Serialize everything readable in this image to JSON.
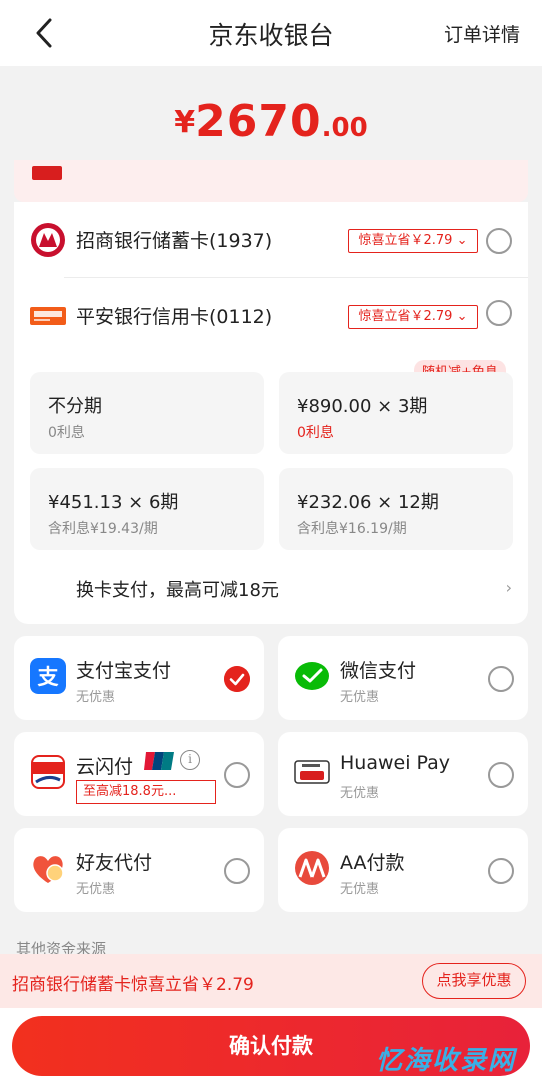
{
  "header": {
    "title": "京东收银台",
    "order_detail": "订单详情"
  },
  "amount": {
    "currency": "¥",
    "integer": "2670",
    "decimal": ".00"
  },
  "banks": [
    {
      "name": "招商银行储蓄卡(1937)",
      "promo": "惊喜立省￥2.79",
      "selected": false
    },
    {
      "name": "平安银行信用卡(0112)",
      "promo": "惊喜立省￥2.79",
      "selected": false
    }
  ],
  "installments": {
    "badge": "随机减+免息",
    "options": [
      {
        "main": "不分期",
        "sub": "0利息"
      },
      {
        "main": "¥890.00 × 3期",
        "sub": "0利息"
      },
      {
        "main": "¥451.13 × 6期",
        "sub": "含利息¥19.43/期"
      },
      {
        "main": "¥232.06 × 12期",
        "sub": "含利息¥16.19/期"
      }
    ]
  },
  "switch_card": {
    "label": "换卡支付，最高可减18元",
    "arrow": "›"
  },
  "payments": [
    {
      "name": "支付宝支付",
      "sub": "无优惠",
      "icon": "alipay-icon",
      "selected": true
    },
    {
      "name": "微信支付",
      "sub": "无优惠",
      "icon": "wechat-icon",
      "selected": false
    },
    {
      "name": "云闪付",
      "promo": "至高减18.8元...",
      "icon": "cloud-quickpass-icon",
      "selected": false
    },
    {
      "name": "Huawei Pay",
      "sub": "无优惠",
      "icon": "huawei-pay-icon",
      "selected": false
    },
    {
      "name": "好友代付",
      "sub": "无优惠",
      "icon": "friend-pay-icon",
      "selected": false
    },
    {
      "name": "AA付款",
      "sub": "无优惠",
      "icon": "aa-pay-icon",
      "selected": false
    }
  ],
  "other_sources": "其他资金来源",
  "bottom_promo": {
    "text": "招商银行储蓄卡惊喜立省￥2.79",
    "button": "点我享优惠"
  },
  "confirm_button": "确认付款",
  "watermark": "忆海收录网",
  "colors": {
    "accent": "#e4231d",
    "alipay": "#1677ff",
    "wechat": "#09bb07"
  }
}
